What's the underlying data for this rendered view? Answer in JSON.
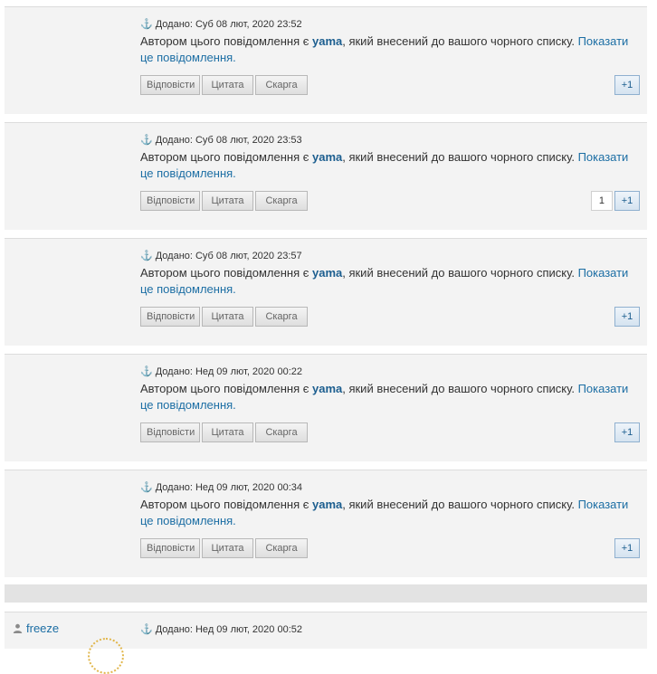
{
  "labels": {
    "reply": "Відповісти",
    "quote": "Цитата",
    "report": "Скарга",
    "plus_one": "+1",
    "msg_prefix": "Автором цього повідомлення є ",
    "msg_suffix": ", який внесений до вашого чорного списку. ",
    "show_link": "Показати це повідомлення."
  },
  "posts": [
    {
      "meta": "Додано: Суб 08 лют, 2020 23:52",
      "author": "yama",
      "vote_count": ""
    },
    {
      "meta": "Додано: Суб 08 лют, 2020 23:53",
      "author": "yama",
      "vote_count": "1"
    },
    {
      "meta": "Додано: Суб 08 лют, 2020 23:57",
      "author": "yama",
      "vote_count": ""
    },
    {
      "meta": "Додано: Нед 09 лют, 2020 00:22",
      "author": "yama",
      "vote_count": ""
    },
    {
      "meta": "Додано: Нед 09 лют, 2020 00:34",
      "author": "yama",
      "vote_count": ""
    }
  ],
  "last_post": {
    "username": "freeze",
    "meta": "Додано: Нед 09 лют, 2020 00:52"
  },
  "icons": {
    "post_anchor": "anchor-icon",
    "user": "user-icon"
  }
}
